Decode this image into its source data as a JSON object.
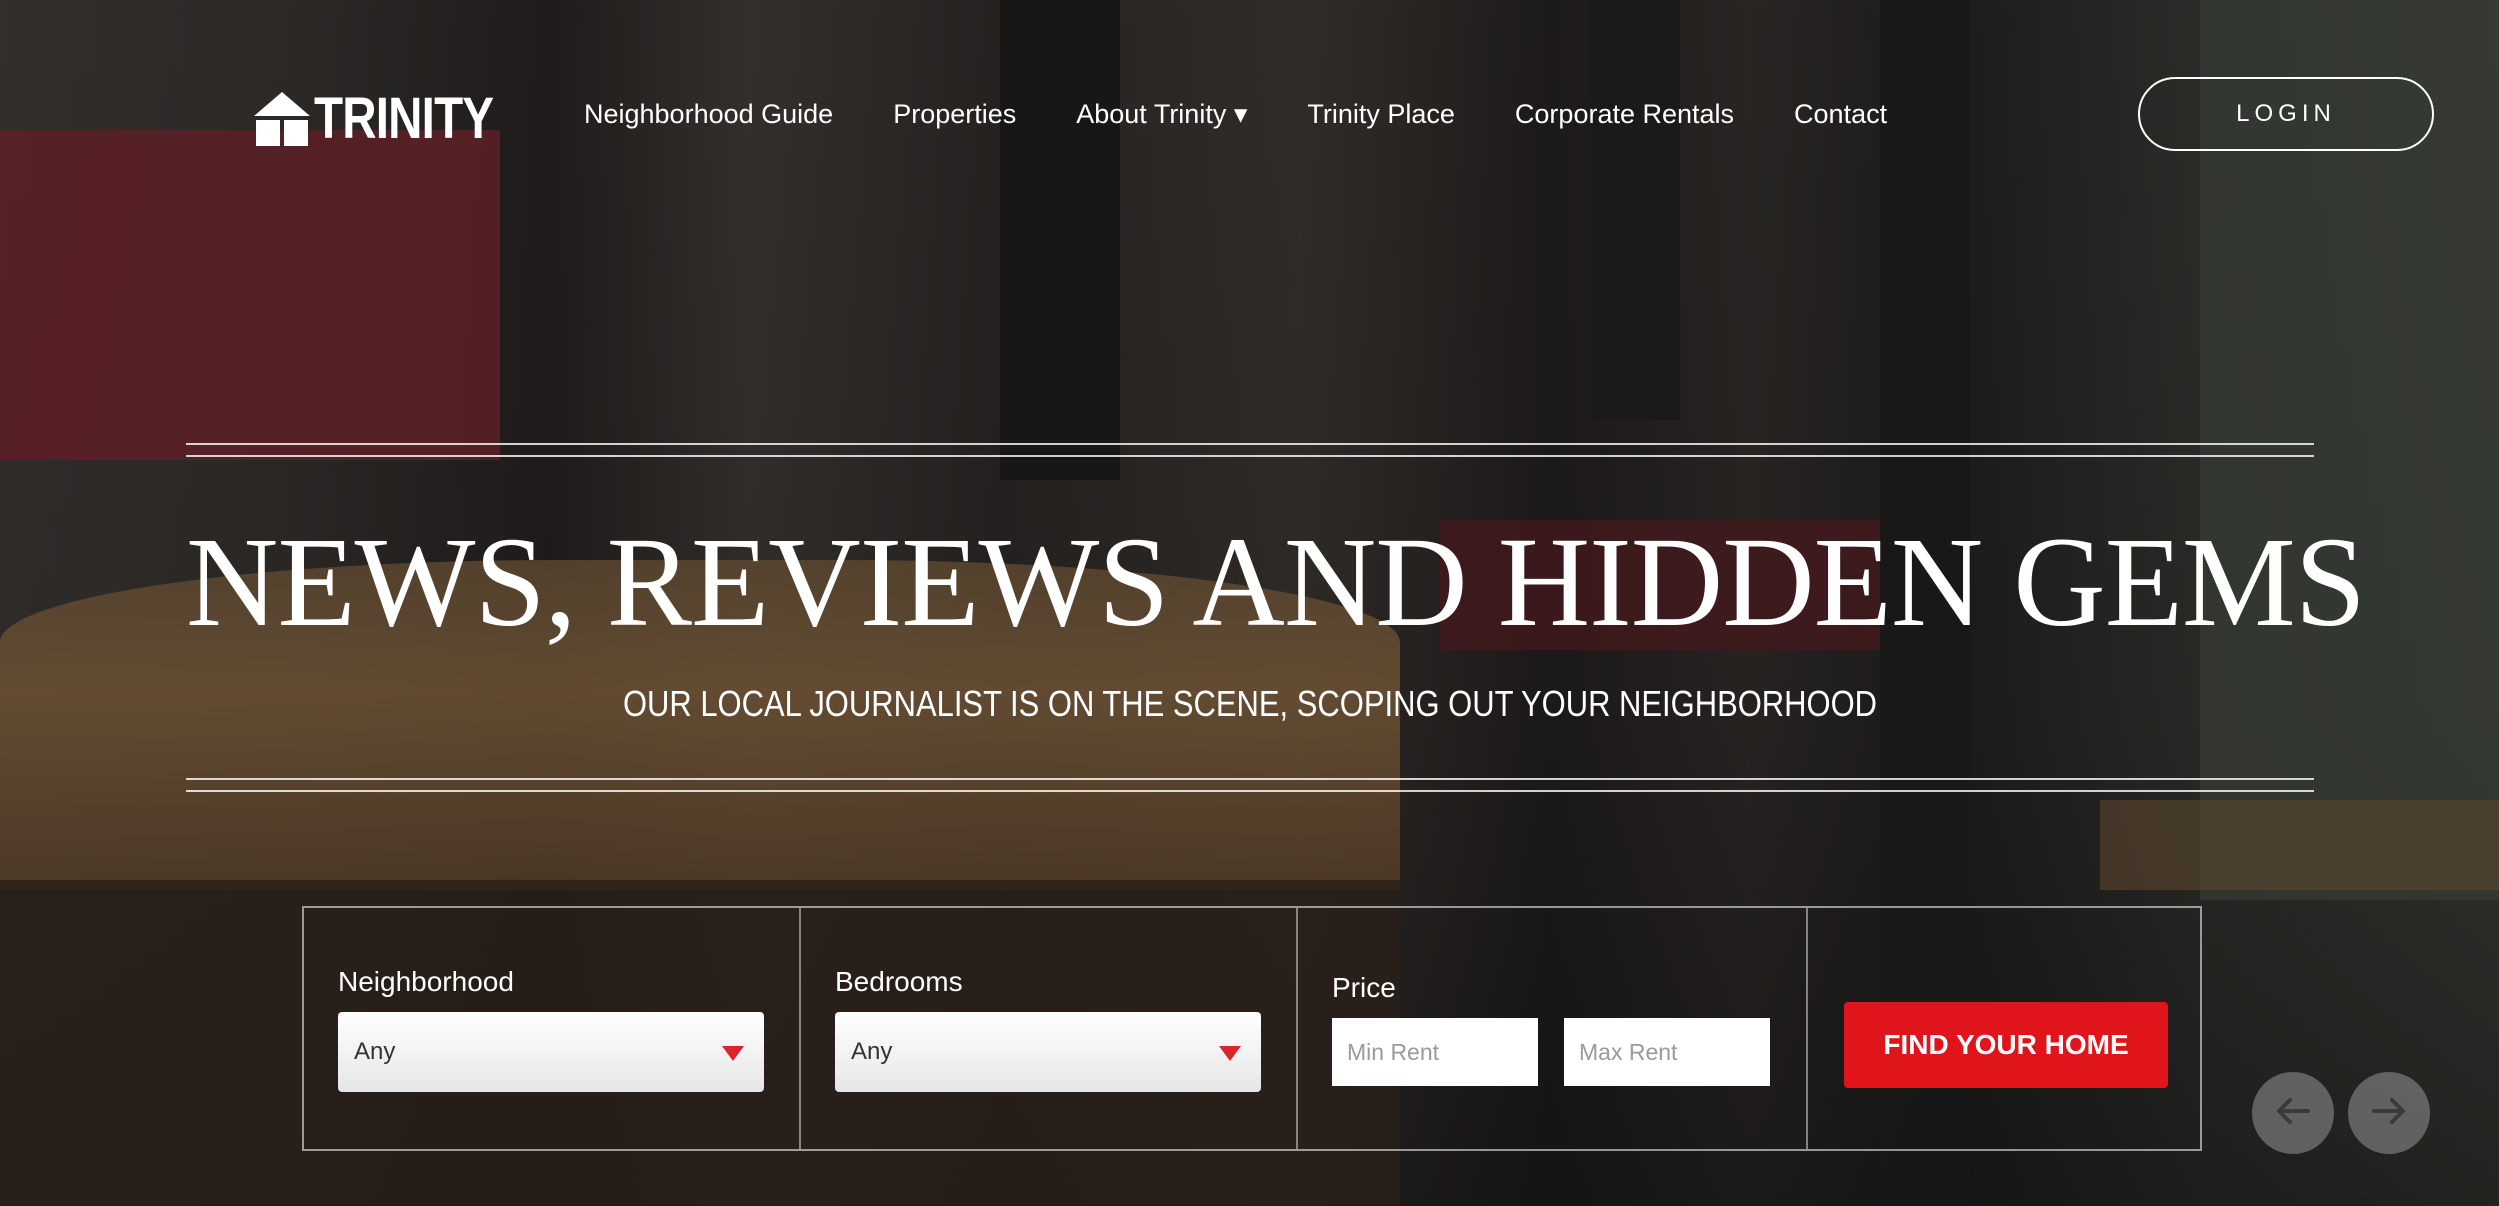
{
  "brand": {
    "name": "TRINITY"
  },
  "nav": {
    "items": [
      {
        "label": "Neighborhood Guide"
      },
      {
        "label": "Properties"
      },
      {
        "label": "About Trinity ▾"
      },
      {
        "label": "Trinity Place"
      },
      {
        "label": "Corporate Rentals"
      },
      {
        "label": "Contact"
      }
    ],
    "login_label": "LOGIN"
  },
  "hero": {
    "title": "NEWS, REVIEWS AND HIDDEN GEMS",
    "subtitle": "OUR LOCAL JOURNALIST IS ON THE SCENE, SCOPING OUT YOUR NEIGHBORHOOD"
  },
  "search": {
    "neighborhood": {
      "label": "Neighborhood",
      "value": "Any"
    },
    "bedrooms": {
      "label": "Bedrooms",
      "value": "Any"
    },
    "price": {
      "label": "Price",
      "min_placeholder": "Min Rent",
      "max_placeholder": "Max Rent"
    },
    "submit_label": "FIND YOUR HOME"
  },
  "carousel": {
    "prev_icon": "arrow-left-icon",
    "next_icon": "arrow-right-icon"
  },
  "colors": {
    "accent": "#e0151b",
    "select_arrow": "#d8262c"
  }
}
